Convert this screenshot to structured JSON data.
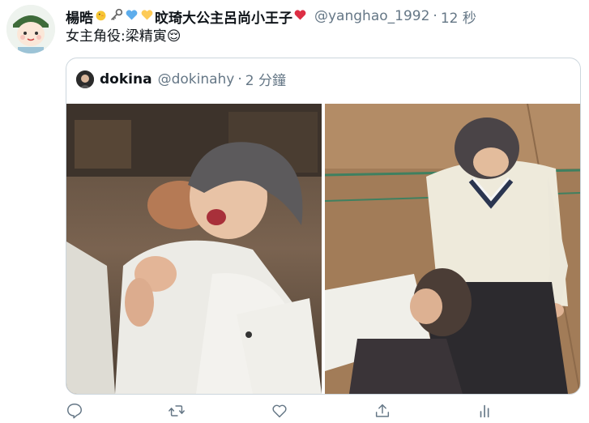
{
  "tweet": {
    "display_name": "楊晧",
    "display_name_suffix": "旼琦大公主呂尚小王子",
    "emojis": [
      "chick",
      "key",
      "blue-heart",
      "yellow-heart",
      "red-heart"
    ],
    "handle": "@yanghao_1992",
    "separator": "·",
    "time": "12 秒",
    "text": "女主角役:梁精寅😌"
  },
  "quote": {
    "display_name": "dokina",
    "handle": "@dokinahy",
    "separator": "·",
    "time": "2 分鐘"
  },
  "actions": [
    "reply-icon",
    "retweet-icon",
    "like-icon",
    "share-icon",
    "analytics-icon"
  ],
  "colors": {
    "secondary_text": "#657786",
    "border": "#ccd6dd",
    "icon": "#657786"
  }
}
